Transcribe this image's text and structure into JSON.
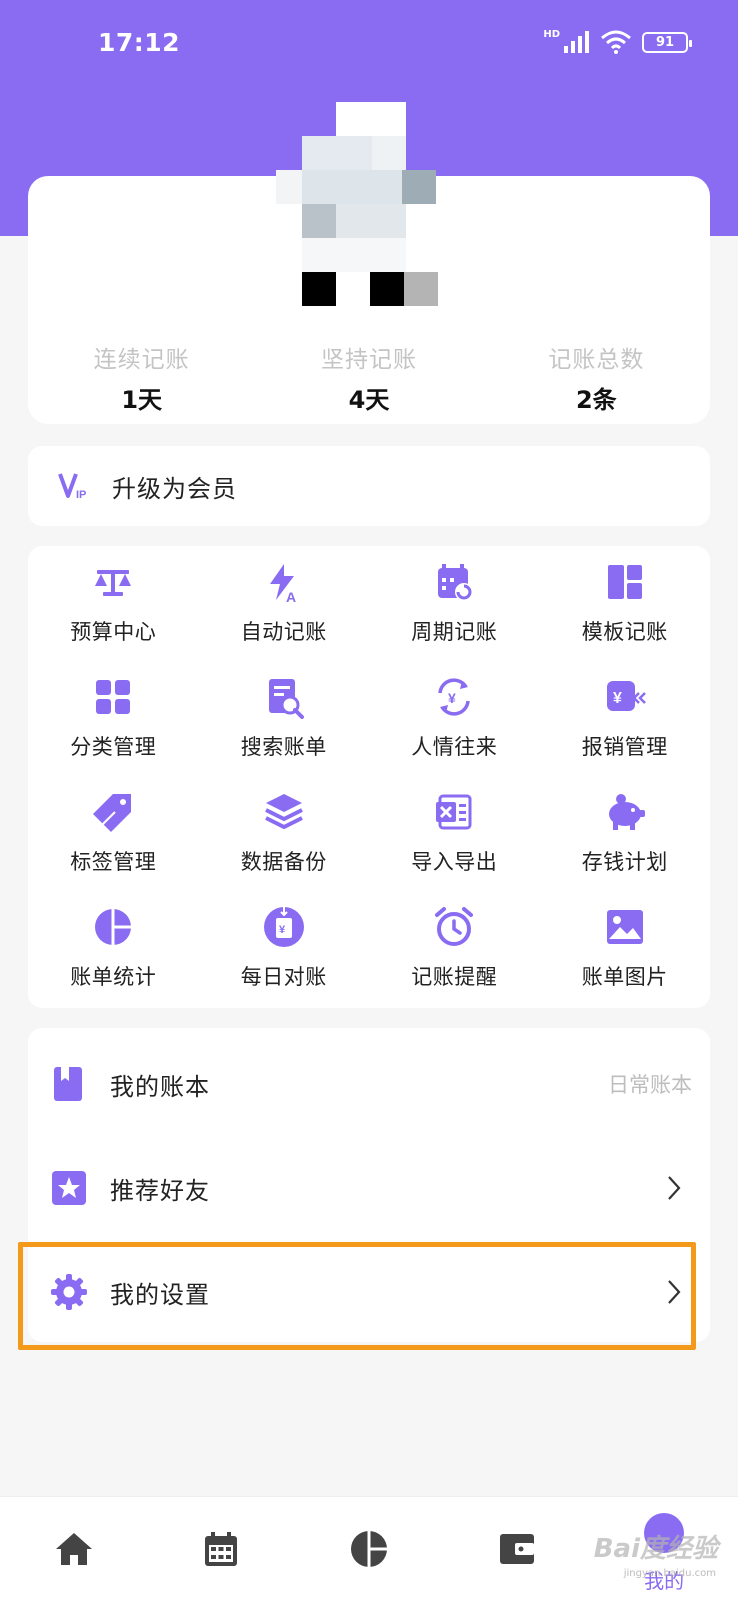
{
  "status_bar": {
    "time": "17:12",
    "network": "HD",
    "battery": "91"
  },
  "profile": {
    "stats": [
      {
        "label": "连续记账",
        "value": "1天"
      },
      {
        "label": "坚持记账",
        "value": "4天"
      },
      {
        "label": "记账总数",
        "value": "2条"
      }
    ]
  },
  "vip": {
    "label": "升级为会员",
    "icon_text": "VIP"
  },
  "features": [
    {
      "label": "预算中心",
      "icon": "balance-scale-icon"
    },
    {
      "label": "自动记账",
      "icon": "auto-bolt-icon"
    },
    {
      "label": "周期记账",
      "icon": "calendar-cycle-icon"
    },
    {
      "label": "模板记账",
      "icon": "template-grid-icon"
    },
    {
      "label": "分类管理",
      "icon": "category-grid-icon"
    },
    {
      "label": "搜索账单",
      "icon": "search-bill-icon"
    },
    {
      "label": "人情往来",
      "icon": "exchange-yen-icon"
    },
    {
      "label": "报销管理",
      "icon": "reimburse-icon"
    },
    {
      "label": "标签管理",
      "icon": "tag-icon"
    },
    {
      "label": "数据备份",
      "icon": "layers-icon"
    },
    {
      "label": "导入导出",
      "icon": "excel-icon"
    },
    {
      "label": "存钱计划",
      "icon": "piggy-bank-icon"
    },
    {
      "label": "账单统计",
      "icon": "pie-chart-icon"
    },
    {
      "label": "每日对账",
      "icon": "daily-check-icon"
    },
    {
      "label": "记账提醒",
      "icon": "alarm-clock-icon"
    },
    {
      "label": "账单图片",
      "icon": "image-icon"
    }
  ],
  "list": {
    "ledger": {
      "label": "我的账本",
      "value": "日常账本"
    },
    "invite": {
      "label": "推荐好友"
    },
    "settings": {
      "label": "我的设置"
    }
  },
  "tabbar": {
    "active_label": "我的"
  },
  "watermark": {
    "text": "Bai度经验",
    "sub": "jingyan.baidu.com"
  },
  "colors": {
    "brand": "#8a6cf2",
    "highlight": "#f39a1b"
  }
}
